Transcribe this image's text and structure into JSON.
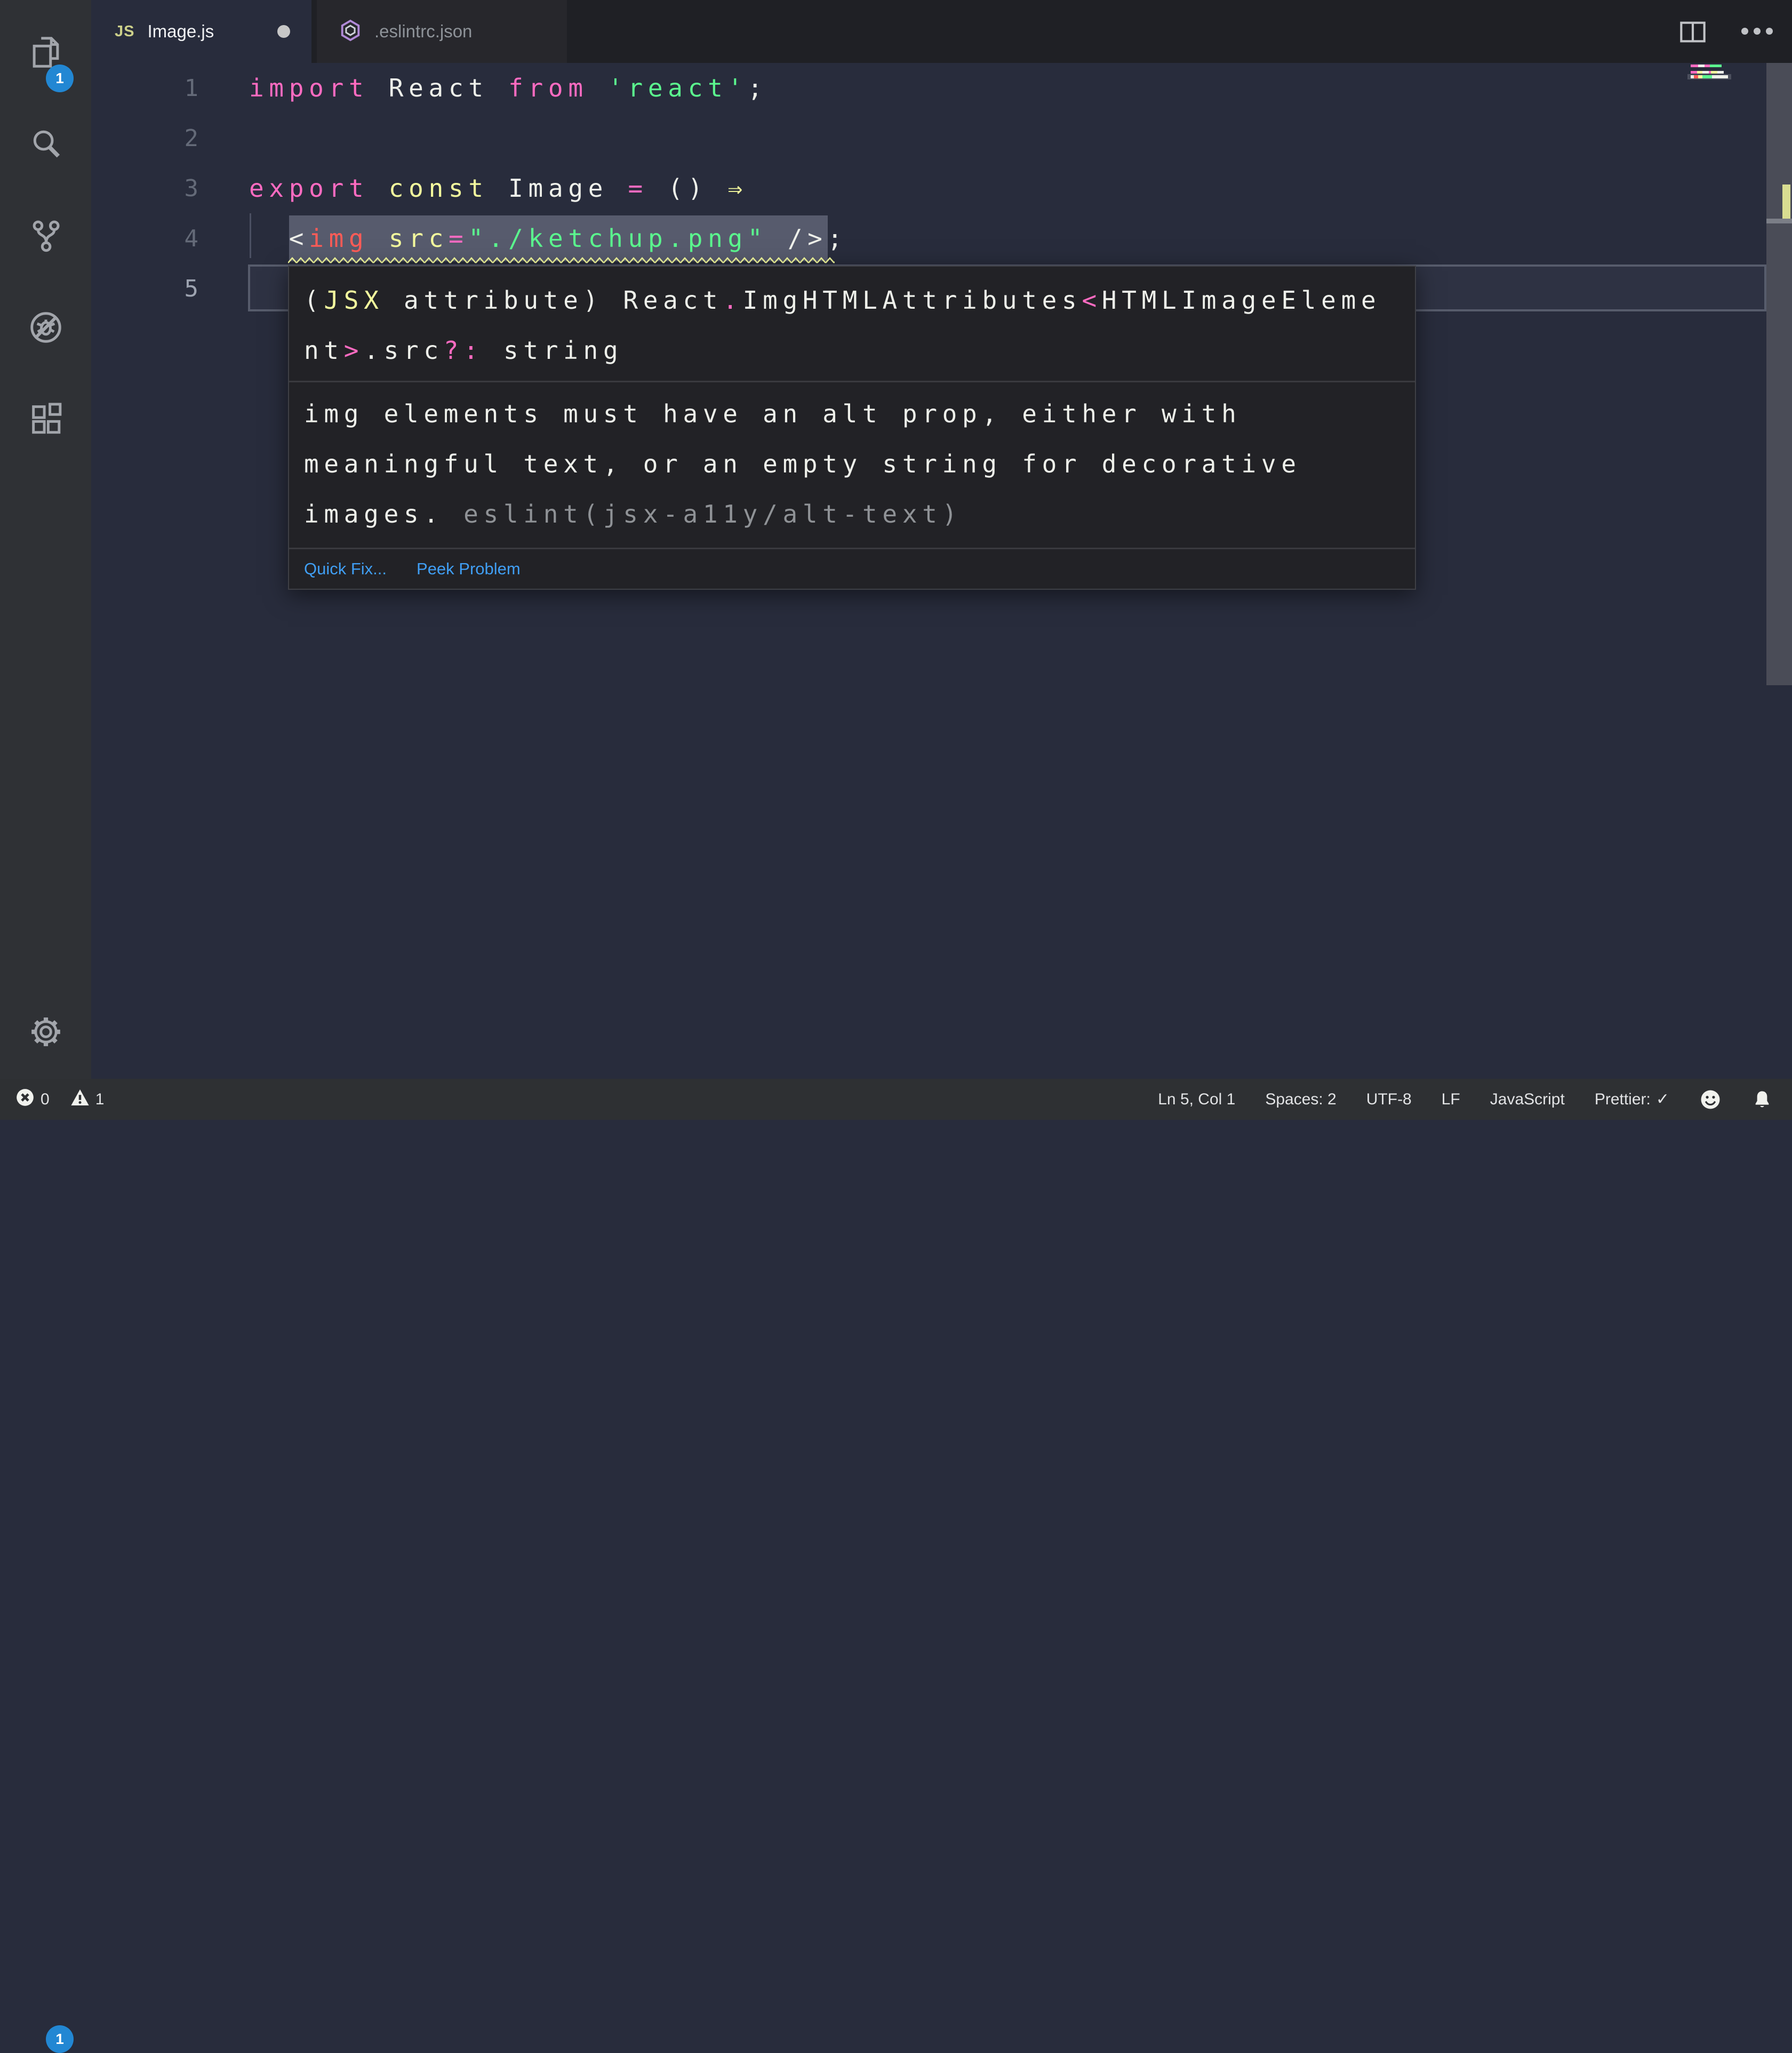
{
  "colors": {
    "editor_bg": "#282c3c",
    "activity_bar_bg": "#2f3135",
    "tab_bar_bg": "#1f2025",
    "keyword_pink": "#ff6bc1",
    "attr_yellow": "#f3f99d",
    "string_green": "#5bf78e",
    "tag_red": "#ff5c57",
    "foreground": "#eef0ea",
    "badge_blue": "#2287d3",
    "link_blue": "#409ff5",
    "squiggle_yellow": "#f3f99d",
    "selection": "#575b6d"
  },
  "activity_bar": {
    "explorer_badge": "1",
    "manage_badge": "1",
    "items": [
      "explorer",
      "search",
      "source-control",
      "debug",
      "extensions",
      "manage"
    ]
  },
  "tabs": [
    {
      "label": "Image.js",
      "icon": "js",
      "active": true,
      "dirty": true
    },
    {
      "label": ".eslintrc.json",
      "icon": "eslint",
      "active": false,
      "dirty": false
    }
  ],
  "code": {
    "lines": [
      {
        "num": "1",
        "tokens": [
          [
            "import",
            "pink"
          ],
          [
            " React ",
            "fg"
          ],
          [
            "from",
            "pink"
          ],
          [
            " ",
            "fg"
          ],
          [
            "'react'",
            "green"
          ],
          [
            ";",
            "fg"
          ]
        ]
      },
      {
        "num": "2",
        "tokens": []
      },
      {
        "num": "3",
        "tokens": [
          [
            "export",
            "pink"
          ],
          [
            " ",
            "fg"
          ],
          [
            "const",
            "yellow"
          ],
          [
            " Image ",
            "fg"
          ],
          [
            "=",
            "pink"
          ],
          [
            " () ",
            "fg"
          ],
          [
            "⇒",
            "yellow"
          ]
        ]
      },
      {
        "num": "4",
        "tokens": [
          [
            "  ",
            "fg"
          ],
          [
            "<",
            "fg",
            "sel"
          ],
          [
            "img",
            "red",
            "sel"
          ],
          [
            " ",
            "fg",
            "sel"
          ],
          [
            "src",
            "yellow",
            "sel"
          ],
          [
            "=",
            "pink",
            "sel"
          ],
          [
            "\"./ketchup.png\"",
            "green",
            "sel"
          ],
          [
            " />",
            "fg",
            "sel"
          ],
          [
            ";",
            "fg"
          ]
        ]
      },
      {
        "num": "5",
        "tokens": [],
        "active": true
      }
    ]
  },
  "hover": {
    "type_lines": [
      [
        [
          "(",
          "fg"
        ],
        [
          "JSX",
          "yellow"
        ],
        [
          " attribute) React",
          "fg"
        ],
        [
          ".",
          "pink"
        ],
        [
          "ImgHTMLAttributes",
          "fg"
        ],
        [
          "<",
          "pink"
        ],
        [
          "HTMLImageEleme",
          "fg"
        ]
      ],
      [
        [
          "nt",
          "fg"
        ],
        [
          ">",
          "pink"
        ],
        [
          ".src",
          "fg"
        ],
        [
          "?:",
          "pink"
        ],
        [
          " string",
          "fg"
        ]
      ]
    ],
    "message_lines": [
      "img elements must have an alt prop, either with",
      "meaningful text, or an empty string for decorative"
    ],
    "message_tail": "images. ",
    "message_rule": "eslint(jsx-a11y/alt-text)",
    "actions": [
      {
        "label": "Quick Fix..."
      },
      {
        "label": "Peek Problem"
      }
    ]
  },
  "status_bar": {
    "errors": "0",
    "warnings": "1",
    "items": [
      {
        "label": "Ln 5, Col 1"
      },
      {
        "label": "Spaces: 2"
      },
      {
        "label": "UTF-8"
      },
      {
        "label": "LF"
      },
      {
        "label": "JavaScript"
      },
      {
        "label": "Prettier:",
        "check": "✓"
      }
    ]
  }
}
